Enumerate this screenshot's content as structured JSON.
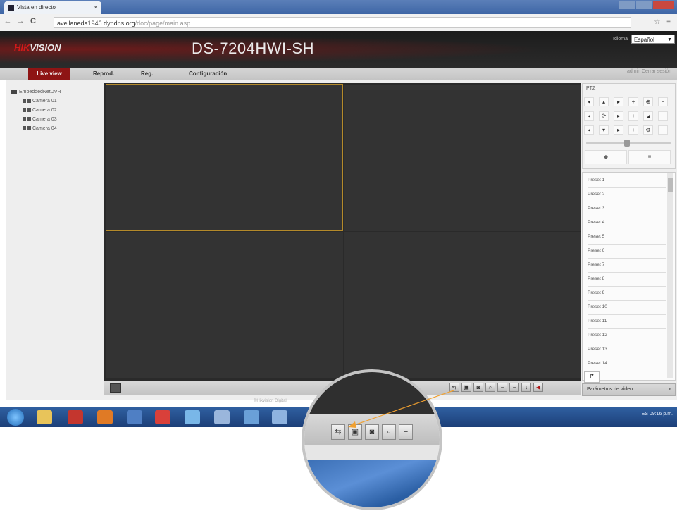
{
  "browser": {
    "tab_title": "Vista en directo",
    "url_host": "avellaneda1946.dyndns.org",
    "url_path": "/doc/page/main.asp",
    "nav_back": "←",
    "nav_forward": "→",
    "nav_reload": "C",
    "icons_right": "☆ ≡"
  },
  "header": {
    "logo_prefix": "HIK",
    "logo_suffix": "VISION",
    "model": "DS-7204HWI-SH",
    "language_label": "Idioma",
    "language_value": "Español"
  },
  "menu": {
    "live_view": "Live view",
    "playback": "Reprod.",
    "log": "Reg.",
    "config": "Configuración",
    "user": "admin  Cerrar sesión"
  },
  "tree": {
    "root": "EmbeddedNetDVR",
    "cameras": [
      "Camera 01",
      "Camera 02",
      "Camera 03",
      "Camera 04"
    ]
  },
  "ptz": {
    "title": "PTZ",
    "rows": [
      [
        "◂",
        "▴",
        "▸",
        "+",
        "⊕",
        "−"
      ],
      [
        "◂",
        "⟳",
        "▸",
        "+",
        "◢",
        "−"
      ],
      [
        "◂",
        "▾",
        "▸",
        "+",
        "⚙",
        "−"
      ]
    ],
    "btn_left": "◆",
    "btn_right": "≡"
  },
  "presets": {
    "items": [
      "Preset 1",
      "Preset 2",
      "Preset 3",
      "Preset 4",
      "Preset 5",
      "Preset 6",
      "Preset 7",
      "Preset 8",
      "Preset 9",
      "Preset 10",
      "Preset 11",
      "Preset 12",
      "Preset 13",
      "Preset 14"
    ],
    "goto_icon": "↱"
  },
  "video_params": {
    "label": "Parámetros de vídeo",
    "arrow": "»"
  },
  "toolbar": {
    "buttons": [
      "⇆",
      "▣",
      "◙",
      "⌕",
      "−",
      "−",
      "↓",
      "◀"
    ]
  },
  "footer": {
    "text": "©Hikvision Digital"
  },
  "taskbar": {
    "time": "09:16 p.m.",
    "tray": "ES"
  },
  "magnifier": {
    "buttons": [
      "⇆",
      "▣",
      "◙",
      "⌕",
      "−"
    ]
  }
}
